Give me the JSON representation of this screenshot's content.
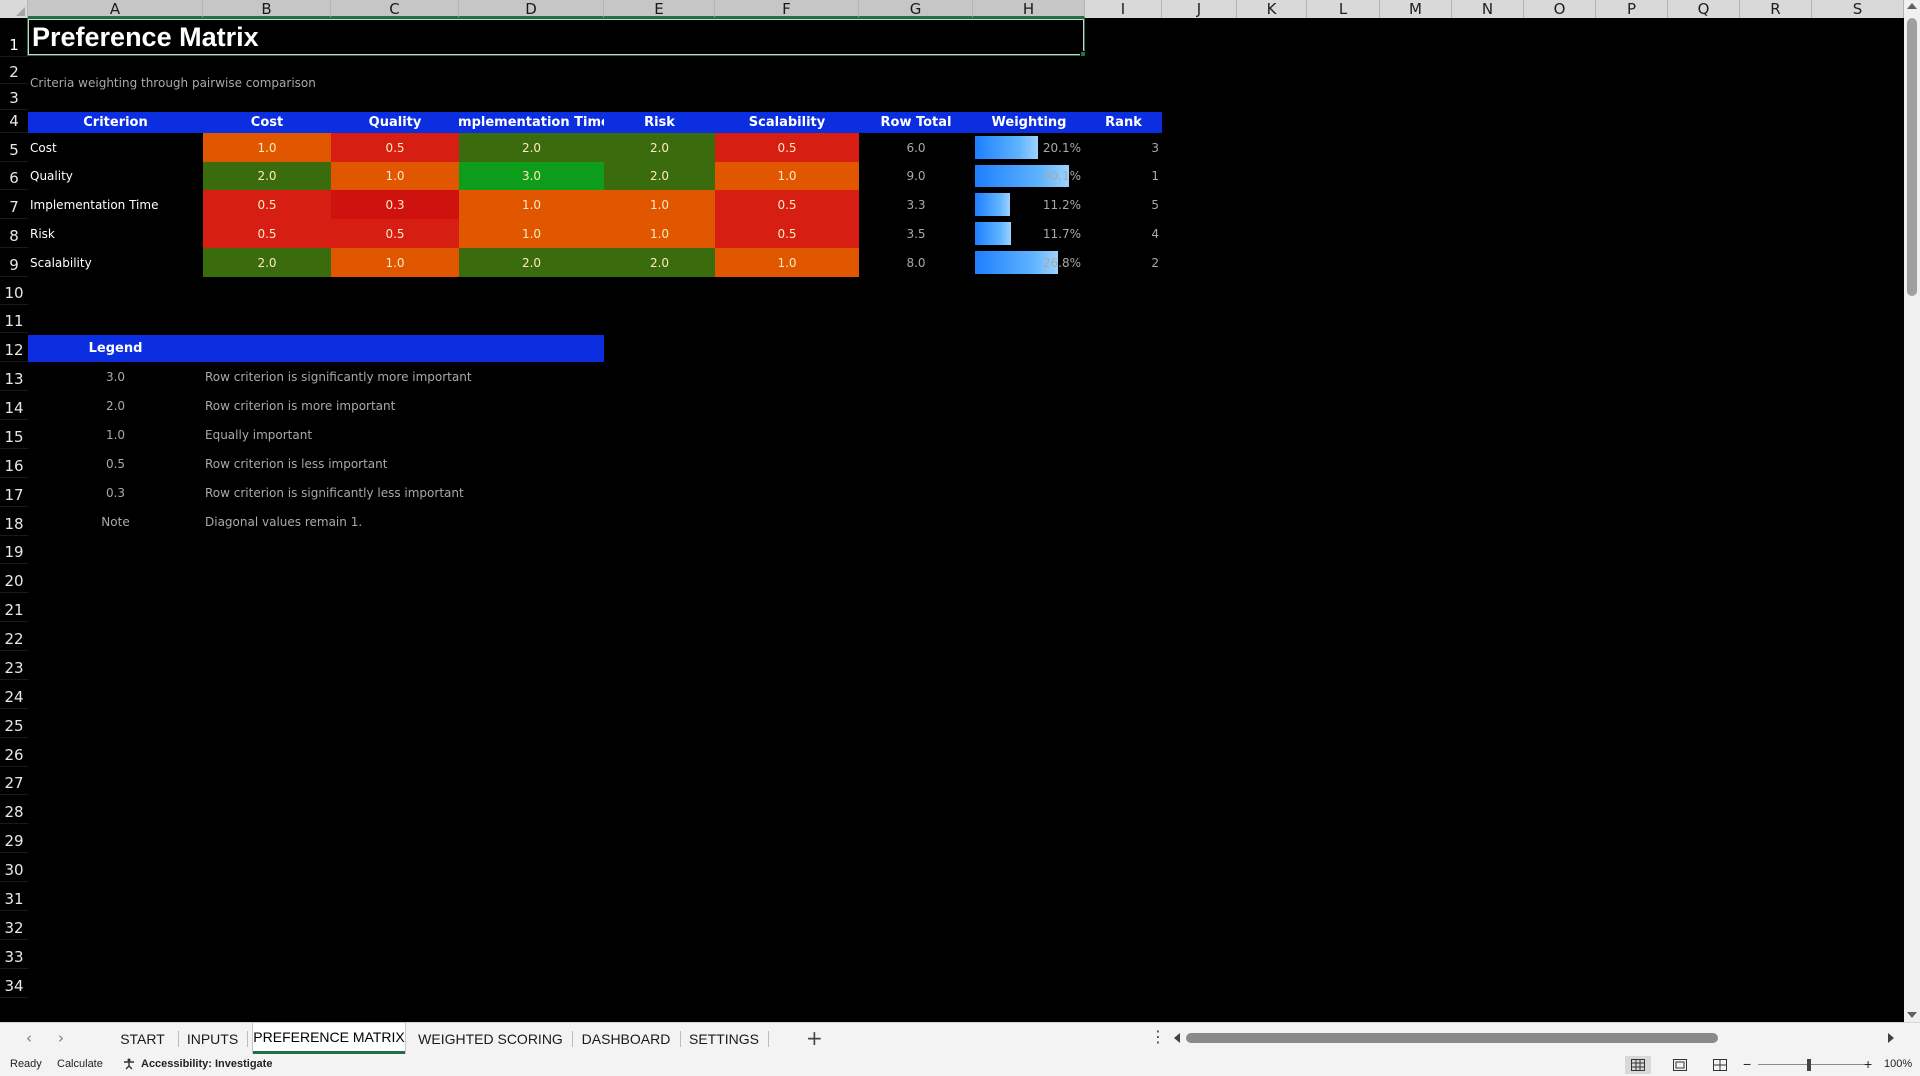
{
  "columns": [
    "A",
    "B",
    "C",
    "D",
    "E",
    "F",
    "G",
    "H",
    "I",
    "J",
    "K",
    "L",
    "M",
    "N",
    "O",
    "P",
    "Q",
    "R",
    "S"
  ],
  "rows": [
    "1",
    "2",
    "3",
    "4",
    "5",
    "6",
    "7",
    "8",
    "9",
    "10",
    "11",
    "12",
    "13",
    "14",
    "15",
    "16",
    "17",
    "18",
    "19",
    "20",
    "21",
    "22",
    "23",
    "24",
    "25",
    "26",
    "27",
    "28",
    "29",
    "30",
    "31",
    "32",
    "33",
    "34"
  ],
  "title": "Preference Matrix",
  "subtitle": "Criteria weighting through pairwise comparison",
  "matrix": {
    "headers": [
      "Criterion",
      "Cost",
      "Quality",
      "Implementation Time",
      "Risk",
      "Scalability",
      "Row Total",
      "Weighting",
      "Rank"
    ],
    "rows": [
      {
        "name": "Cost",
        "values": [
          "1.0",
          "0.5",
          "2.0",
          "2.0",
          "0.5"
        ],
        "total": "6.0",
        "weight": "20.1%",
        "weight_fraction": 0.201,
        "rank": "3"
      },
      {
        "name": "Quality",
        "values": [
          "2.0",
          "1.0",
          "3.0",
          "2.0",
          "1.0"
        ],
        "total": "9.0",
        "weight": "30.1%",
        "weight_fraction": 0.301,
        "rank": "1"
      },
      {
        "name": "Implementation Time",
        "values": [
          "0.5",
          "0.3",
          "1.0",
          "1.0",
          "0.5"
        ],
        "total": "3.3",
        "weight": "11.2%",
        "weight_fraction": 0.112,
        "rank": "5"
      },
      {
        "name": "Risk",
        "values": [
          "0.5",
          "0.5",
          "1.0",
          "1.0",
          "0.5"
        ],
        "total": "3.5",
        "weight": "11.7%",
        "weight_fraction": 0.117,
        "rank": "4"
      },
      {
        "name": "Scalability",
        "values": [
          "2.0",
          "1.0",
          "2.0",
          "2.0",
          "1.0"
        ],
        "total": "8.0",
        "weight": "26.8%",
        "weight_fraction": 0.268,
        "rank": "2"
      }
    ]
  },
  "scale_colors": {
    "3.0": "#0e9d1a",
    "2.0": "#3a6b0c",
    "1.0": "#e05700",
    "0.5": "#d61f12",
    "0.3": "#d0120f"
  },
  "legend": {
    "title": "Legend",
    "items": [
      {
        "value": "3.0",
        "text": "Row criterion is significantly more important"
      },
      {
        "value": "2.0",
        "text": "Row criterion is more important"
      },
      {
        "value": "1.0",
        "text": "Equally important"
      },
      {
        "value": "0.5",
        "text": "Row criterion is less important"
      },
      {
        "value": "0.3",
        "text": "Row criterion is significantly less important"
      },
      {
        "value": "Note",
        "text": "Diagonal values remain 1."
      }
    ]
  },
  "tabs": [
    {
      "label": "START",
      "active": false
    },
    {
      "label": "INPUTS",
      "active": false
    },
    {
      "label": "PREFERENCE MATRIX",
      "active": true
    },
    {
      "label": "WEIGHTED SCORING",
      "active": false
    },
    {
      "label": "DASHBOARD",
      "active": false
    },
    {
      "label": "SETTINGS",
      "active": false
    }
  ],
  "status": {
    "ready": "Ready",
    "calculate": "Calculate",
    "accessibility": "Accessibility: Investigate",
    "zoom": "100%"
  },
  "colors": {
    "header_blue": "#0b2fe0",
    "accent_green": "#1f7145",
    "bar_blue": "#1e7fff"
  }
}
